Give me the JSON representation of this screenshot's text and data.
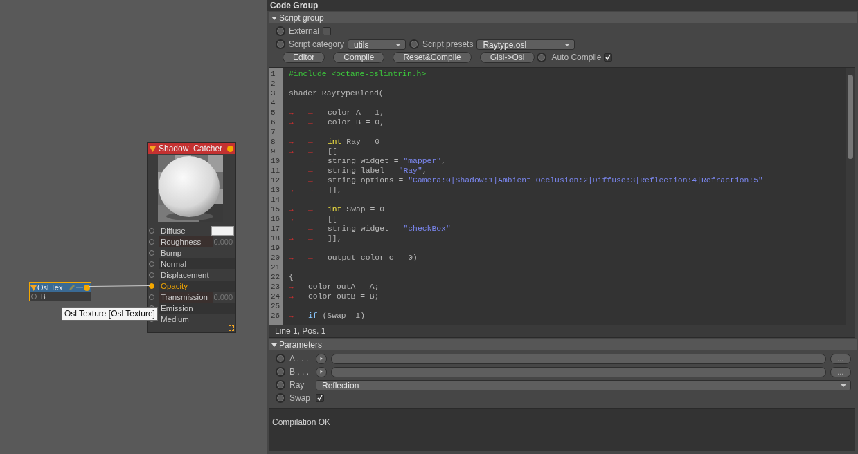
{
  "canvas": {
    "nodes": [
      {
        "title": "Shadow_Catcher",
        "kind": "material",
        "ports": [
          {
            "label": "Diffuse",
            "kind": "swatch",
            "connected": false
          },
          {
            "label": "Roughness",
            "kind": "value",
            "value": "0.000",
            "connected": false
          },
          {
            "label": "Bump",
            "kind": "plain",
            "connected": false
          },
          {
            "label": "Normal",
            "kind": "plain",
            "connected": false
          },
          {
            "label": "Displacement",
            "kind": "plain",
            "connected": false
          },
          {
            "label": "Opacity",
            "kind": "plain",
            "connected": true
          },
          {
            "label": "Transmission",
            "kind": "value",
            "value": "0.000",
            "connected": false
          },
          {
            "label": "Emission",
            "kind": "plain",
            "connected": false
          },
          {
            "label": "Medium",
            "kind": "plain",
            "connected": false
          }
        ]
      },
      {
        "title": "Osl Tex",
        "kind": "texture",
        "ports": [
          {
            "label": "B",
            "connected": false
          }
        ]
      }
    ],
    "tooltip": "Osl Texture [Osl Texture]"
  },
  "panel": {
    "title": "Code Group",
    "script_group": {
      "title": "Script group",
      "external": {
        "label": "External",
        "keyed": false,
        "checked": false
      },
      "script_category": {
        "label": "Script category",
        "keyed": false,
        "value": "utils"
      },
      "script_presets": {
        "label": "Script presets",
        "keyed": false,
        "value": "Raytype.osl"
      },
      "buttons": [
        "Editor",
        "Compile",
        "Reset&Compile",
        "Glsl->Osl"
      ],
      "auto_compile": {
        "label": "Auto Compile",
        "keyed": false,
        "checked": true
      }
    },
    "editor": {
      "lines": [
        {
          "n": "1",
          "parts": [
            {
              "kind": "pre",
              "text": "#include <octane-oslintrin.h>"
            }
          ]
        },
        {
          "n": "2"
        },
        {
          "n": "3",
          "parts": [
            {
              "kind": "plain",
              "text": "shader RaytypeBlend("
            }
          ]
        },
        {
          "n": "4"
        },
        {
          "n": "5",
          "parts": [
            {
              "kind": "tab",
              "text": "→"
            },
            {
              "kind": "tab",
              "text": "→"
            },
            {
              "kind": "plain",
              "text": "color A = 1,"
            }
          ]
        },
        {
          "n": "6",
          "parts": [
            {
              "kind": "tab",
              "text": "→"
            },
            {
              "kind": "tab",
              "text": "→"
            },
            {
              "kind": "plain",
              "text": "color B = 0,"
            }
          ]
        },
        {
          "n": "7"
        },
        {
          "n": "8",
          "parts": [
            {
              "kind": "tab",
              "text": "→"
            },
            {
              "kind": "tab",
              "text": "→"
            },
            {
              "kind": "type",
              "text": "int"
            },
            {
              "kind": "plain",
              "text": " Ray = 0"
            }
          ]
        },
        {
          "n": "9",
          "parts": [
            {
              "kind": "tab",
              "text": "→"
            },
            {
              "kind": "tab",
              "text": "→"
            },
            {
              "kind": "plain",
              "text": "[["
            }
          ]
        },
        {
          "n": "10",
          "parts": [
            {
              "kind": "gap"
            },
            {
              "kind": "tab",
              "text": "→"
            },
            {
              "kind": "plain",
              "text": "string widget = "
            },
            {
              "kind": "str",
              "text": "\"mapper\""
            },
            {
              "kind": "plain",
              "text": ","
            }
          ]
        },
        {
          "n": "11",
          "parts": [
            {
              "kind": "gap"
            },
            {
              "kind": "tab",
              "text": "→"
            },
            {
              "kind": "plain",
              "text": "string label = "
            },
            {
              "kind": "str",
              "text": "\"Ray\""
            },
            {
              "kind": "plain",
              "text": ","
            }
          ]
        },
        {
          "n": "12",
          "parts": [
            {
              "kind": "gap"
            },
            {
              "kind": "tab",
              "text": "→"
            },
            {
              "kind": "plain",
              "text": "string options = "
            },
            {
              "kind": "str",
              "text": "\"Camera:0|Shadow:1|Ambient Occlusion:2|Diffuse:3|Reflection:4|Refraction:5\""
            }
          ]
        },
        {
          "n": "13",
          "parts": [
            {
              "kind": "tab",
              "text": "→"
            },
            {
              "kind": "tab",
              "text": "→"
            },
            {
              "kind": "plain",
              "text": "]],"
            }
          ]
        },
        {
          "n": "14"
        },
        {
          "n": "15",
          "parts": [
            {
              "kind": "tab",
              "text": "→"
            },
            {
              "kind": "tab",
              "text": "→"
            },
            {
              "kind": "type",
              "text": "int"
            },
            {
              "kind": "plain",
              "text": " Swap = 0"
            }
          ]
        },
        {
          "n": "16",
          "parts": [
            {
              "kind": "tab",
              "text": "→"
            },
            {
              "kind": "tab",
              "text": "→"
            },
            {
              "kind": "plain",
              "text": "[["
            }
          ]
        },
        {
          "n": "17",
          "parts": [
            {
              "kind": "gap"
            },
            {
              "kind": "tab",
              "text": "→"
            },
            {
              "kind": "plain",
              "text": "string widget = "
            },
            {
              "kind": "str",
              "text": "\"checkBox\""
            }
          ]
        },
        {
          "n": "18",
          "parts": [
            {
              "kind": "tab",
              "text": "→"
            },
            {
              "kind": "tab",
              "text": "→"
            },
            {
              "kind": "plain",
              "text": "]],"
            }
          ]
        },
        {
          "n": "19"
        },
        {
          "n": "20",
          "parts": [
            {
              "kind": "tab",
              "text": "→"
            },
            {
              "kind": "tab",
              "text": "→"
            },
            {
              "kind": "plain",
              "text": "output color c = 0)"
            }
          ]
        },
        {
          "n": "21"
        },
        {
          "n": "22",
          "parts": [
            {
              "kind": "plain",
              "text": "{"
            }
          ]
        },
        {
          "n": "23",
          "parts": [
            {
              "kind": "tab",
              "text": "→"
            },
            {
              "kind": "plain",
              "text": "color outA = A;"
            }
          ]
        },
        {
          "n": "24",
          "parts": [
            {
              "kind": "tab",
              "text": "→"
            },
            {
              "kind": "plain",
              "text": "color outB = B;"
            }
          ]
        },
        {
          "n": "25"
        },
        {
          "n": "26",
          "parts": [
            {
              "kind": "tab",
              "text": "→"
            },
            {
              "kind": "flow",
              "text": "if"
            },
            {
              "kind": "plain",
              "text": " (Swap==1)"
            }
          ]
        }
      ],
      "status": "Line 1, Pos. 1"
    },
    "parameters": {
      "title": "Parameters",
      "rows": [
        {
          "label": "A . . .",
          "kind": "texture",
          "keyed": false,
          "more": "..."
        },
        {
          "label": "B . . .",
          "kind": "texture",
          "keyed": false,
          "more": "..."
        },
        {
          "label": "Ray",
          "kind": "dropdown",
          "keyed": false,
          "value": "Reflection"
        },
        {
          "label": "Swap",
          "kind": "checkbox",
          "keyed": false,
          "checked": true
        }
      ]
    },
    "output": "Compilation OK"
  }
}
